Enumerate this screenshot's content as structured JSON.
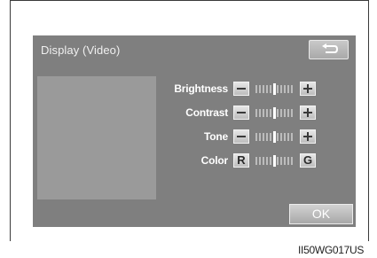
{
  "screen": {
    "title": "Display (Video)",
    "back_icon": "return-arrow-icon",
    "ok_label": "OK"
  },
  "settings": [
    {
      "label": "Brightness",
      "left_control": "−",
      "right_control": "+",
      "level": 0.5
    },
    {
      "label": "Contrast",
      "left_control": "−",
      "right_control": "+",
      "level": 0.5
    },
    {
      "label": "Tone",
      "left_control": "−",
      "right_control": "+",
      "level": 0.5
    },
    {
      "label": "Color",
      "left_control": "R",
      "right_control": "G",
      "level": 0.5
    }
  ],
  "image_code": "II50WG017US",
  "colors": {
    "screen_bg": "#7f7f7f",
    "preview_bg": "#9a9a9a",
    "frame": "#3a3a3a"
  }
}
